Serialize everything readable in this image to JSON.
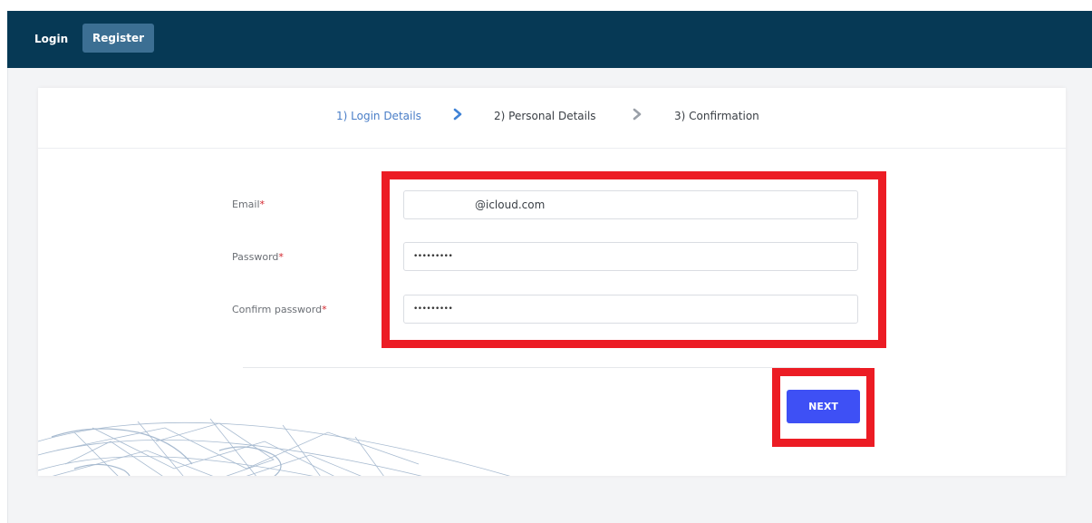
{
  "nav": {
    "login_label": "Login",
    "register_label": "Register"
  },
  "steps": [
    {
      "label": "1) Login Details",
      "active": true
    },
    {
      "label": "2) Personal Details",
      "active": false
    },
    {
      "label": "3) Confirmation",
      "active": false
    }
  ],
  "form": {
    "email": {
      "label": "Email",
      "value": "@icloud.com"
    },
    "password": {
      "label": "Password",
      "value": "•••••••••"
    },
    "confirm_password": {
      "label": "Confirm password",
      "value": "•••••••••"
    },
    "required_marker": "*"
  },
  "next_label": "NEXT",
  "colors": {
    "topbar": "#063955",
    "register_button": "#3c6f93",
    "active_step": "#4a7ec7",
    "next_button": "#3e50f5",
    "highlight": "#ec1c24"
  }
}
